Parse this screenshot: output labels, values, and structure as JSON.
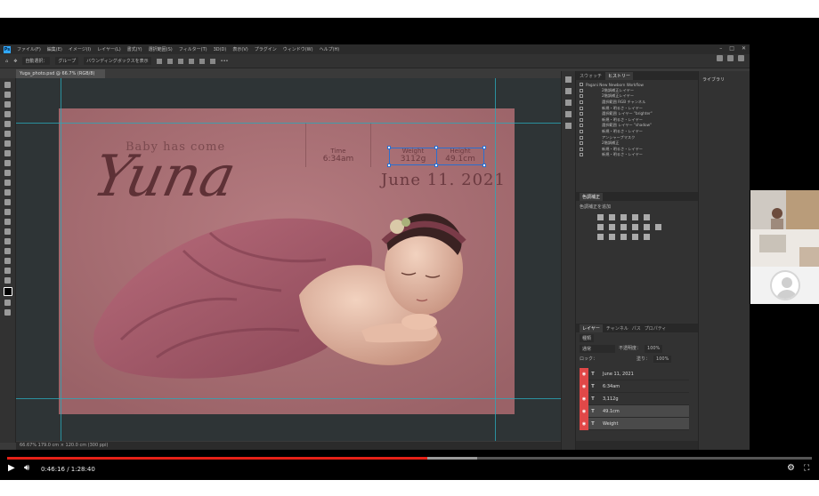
{
  "photoshop": {
    "app_icon": "Ps",
    "menu": [
      "ファイル(F)",
      "編集(E)",
      "イメージ(I)",
      "レイヤー(L)",
      "書式(Y)",
      "選択範囲(S)",
      "フィルター(T)",
      "3D(D)",
      "表示(V)",
      "プラグイン",
      "ウィンドウ(W)",
      "ヘルプ(H)"
    ],
    "options_bar": {
      "auto_select": "自動選択：",
      "group_select": "グループ",
      "transform_controls": "バウンディングボックスを表示"
    },
    "document_tab": "Yuga_photo.psd @ 66.7% (RGB/8)",
    "status_bar": "66.67%    179.0 cm × 120.0 cm (300 ppi)"
  },
  "artboard": {
    "headline": "Baby has come",
    "name_script": "Yuna",
    "time_label": "Time",
    "time_value": "6:34am",
    "weight_label": "Weight",
    "weight_value": "3112g",
    "height_label": "Height",
    "height_value": "49.1cm",
    "date": "June 11. 2021"
  },
  "history_panel": {
    "tabs": [
      "スウォッチ",
      "ヒストリー"
    ],
    "active_tab": "ヒストリー",
    "rows": [
      "Pagani New Newborn Workflow",
      "2階調補正レイヤー",
      "2階調補正レイヤー",
      "選択範囲 RGB チャンネル",
      "新規・明るさ・レイヤー",
      "選択範囲 レイヤー \"brighter\"",
      "新規・明るさ・レイヤー",
      "選択範囲 レイヤー \"shadow\"",
      "新規・明るさ・レイヤー",
      "アンシャープマスク",
      "2階調補正",
      "新規・明るさ・レイヤー",
      "新規・明るさ・レイヤー"
    ]
  },
  "adjustments_panel": {
    "tab": "色調補正",
    "subtitle": "色調補正を追加"
  },
  "layers_panel": {
    "tabs": [
      "レイヤー",
      "チャンネル",
      "パス",
      "プロパティ"
    ],
    "active_tab": "レイヤー",
    "kind_filter": "種類",
    "blend_mode": "通常",
    "opacity_label": "不透明度：",
    "opacity_value": "100%",
    "fill_label": "塗り：",
    "fill_value": "100%",
    "lock_label": "ロック：",
    "layers": [
      "June 11, 2021",
      "6:34am",
      "3,112g",
      "49.1cm",
      "Weight"
    ]
  },
  "properties_panel": {
    "title": "ライブラリ"
  },
  "video_player": {
    "time_display": "0:46:16 / 1:28:40",
    "progress_played": 0.522,
    "progress_buffered": 0.584
  },
  "colors": {
    "accent_blue": "#31a8ff",
    "progress_red": "#e62117",
    "layer_eye_red": "#e04848",
    "artboard_bg": "#a86f74"
  }
}
